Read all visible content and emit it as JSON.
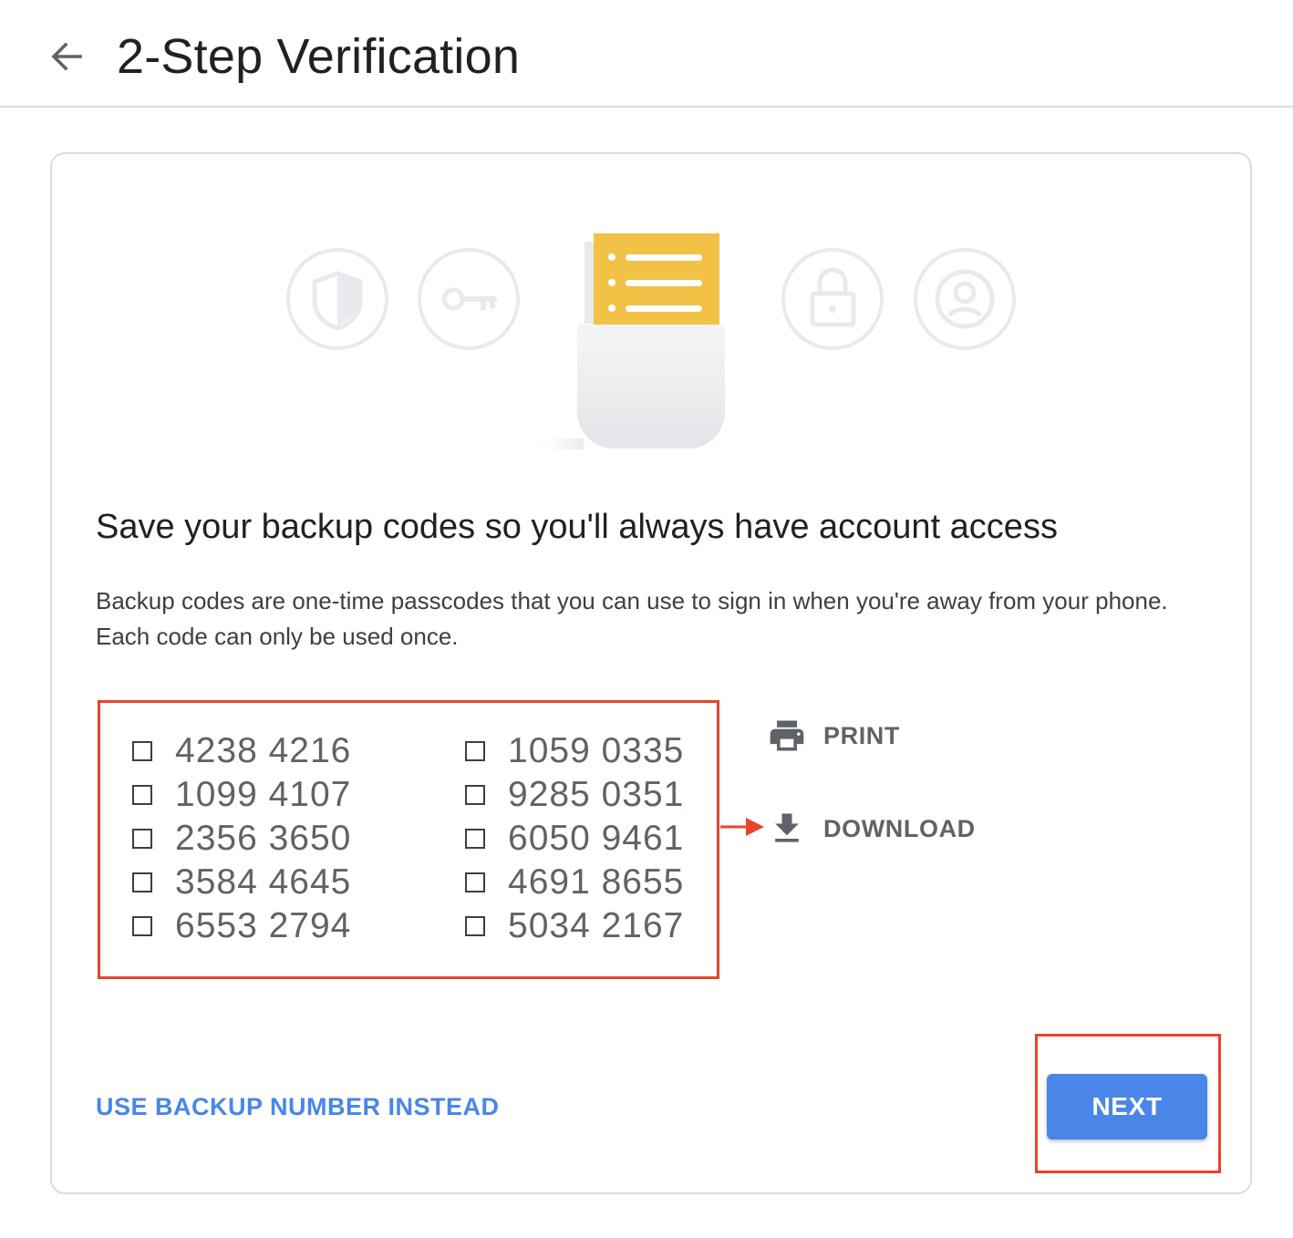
{
  "header": {
    "back_icon": "arrow-back-icon",
    "title": "2-Step Verification"
  },
  "hero": {
    "icons": [
      "shield-icon",
      "key-icon",
      "backup-codes-sheet-icon",
      "lock-icon",
      "account-circle-icon"
    ],
    "accent_color": "#f2c246"
  },
  "card": {
    "heading": "Save your backup codes so you'll always have account access",
    "description": "Backup codes are one-time passcodes that you can use to sign in when you're away from your phone. Each code can only be used once.",
    "codes_left": [
      {
        "code": "4238 4216",
        "checked": false
      },
      {
        "code": "1099 4107",
        "checked": false
      },
      {
        "code": "2356 3650",
        "checked": false
      },
      {
        "code": "3584 4645",
        "checked": false
      },
      {
        "code": "6553 2794",
        "checked": false
      }
    ],
    "codes_right": [
      {
        "code": "1059 0335",
        "checked": false
      },
      {
        "code": "9285 0351",
        "checked": false
      },
      {
        "code": "6050 9461",
        "checked": false
      },
      {
        "code": "4691 8655",
        "checked": false
      },
      {
        "code": "5034 2167",
        "checked": false
      }
    ],
    "actions": {
      "print": {
        "label": "PRINT",
        "icon": "print-icon"
      },
      "download": {
        "label": "DOWNLOAD",
        "icon": "download-icon"
      }
    },
    "backup_link": "USE BACKUP NUMBER INSTEAD",
    "next_label": "NEXT"
  },
  "colors": {
    "primary": "#4a86e8",
    "highlight": "#e8442a",
    "border": "#dadce0"
  }
}
